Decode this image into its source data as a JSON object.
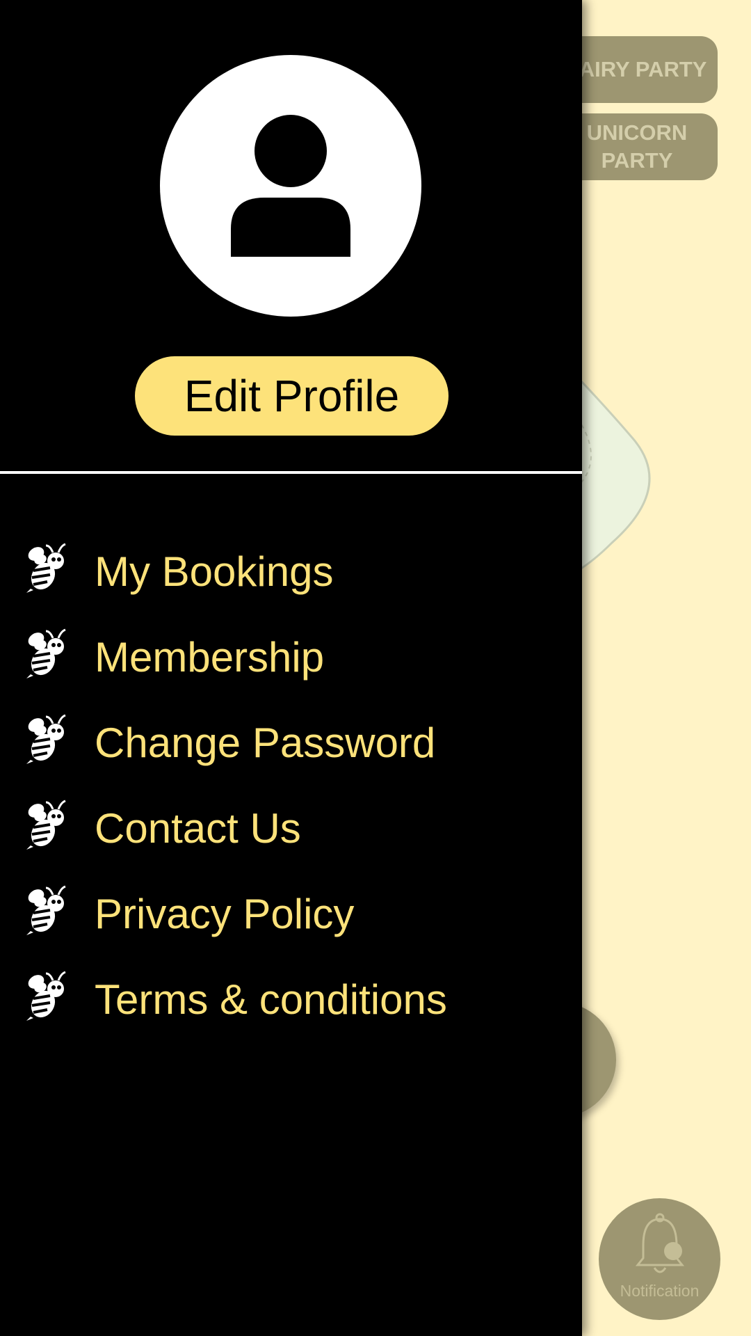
{
  "background": {
    "chips": [
      {
        "label": "FAIRY PARTY"
      },
      {
        "label": "UNICORN PARTY"
      }
    ],
    "notification_label": "Notification"
  },
  "drawer": {
    "edit_profile_label": "Edit Profile",
    "menu_items": [
      {
        "label": "My Bookings",
        "icon": "bee-icon"
      },
      {
        "label": "Membership",
        "icon": "bee-icon"
      },
      {
        "label": "Change Password",
        "icon": "bee-icon"
      },
      {
        "label": "Contact Us",
        "icon": "bee-icon"
      },
      {
        "label": "Privacy Policy",
        "icon": "bee-icon"
      },
      {
        "label": "Terms & conditions",
        "icon": "bee-icon"
      }
    ]
  },
  "colors": {
    "drawer_bg": "#000000",
    "accent_yellow": "#fde27a",
    "page_bg": "#fff3c6",
    "dim_chip": "#9d9671"
  }
}
